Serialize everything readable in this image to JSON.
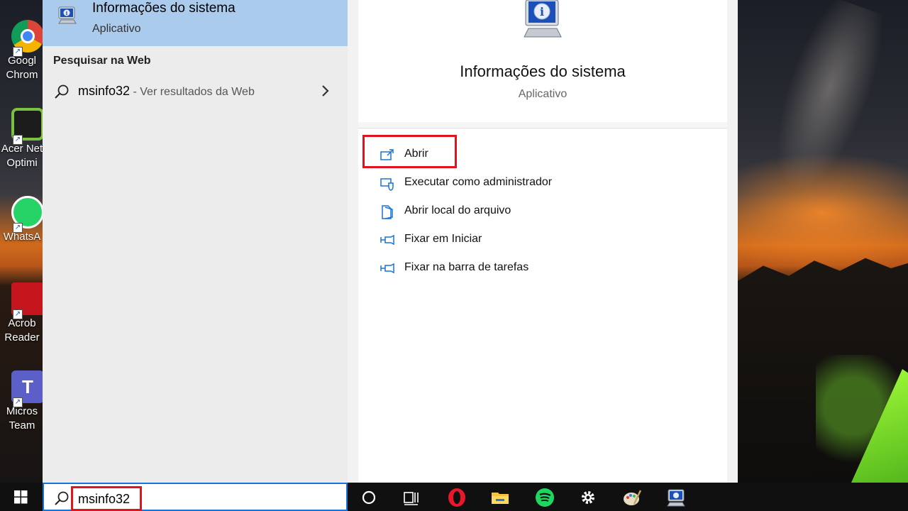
{
  "desktop": {
    "icons": [
      {
        "label": "Googl",
        "label2": "Chrom"
      },
      {
        "label": "Acer Net",
        "label2": "Optimi"
      },
      {
        "label": "WhatsA",
        "label2": ""
      },
      {
        "label": "Acrob",
        "label2": "Reader"
      },
      {
        "label": "Micros",
        "label2": "Team"
      }
    ]
  },
  "results": {
    "best_match": {
      "title": "Informações do sistema",
      "subtitle": "Aplicativo"
    },
    "web_header": "Pesquisar na Web",
    "web_row": {
      "query": "msinfo32",
      "suffix": " - Ver resultados da Web"
    }
  },
  "detail": {
    "title": "Informações do sistema",
    "subtitle": "Aplicativo",
    "actions": [
      {
        "label": "Abrir",
        "icon": "open-icon"
      },
      {
        "label": "Executar como administrador",
        "icon": "shield-icon"
      },
      {
        "label": "Abrir local do arquivo",
        "icon": "file-location-icon"
      },
      {
        "label": "Fixar em Iniciar",
        "icon": "pin-icon"
      },
      {
        "label": "Fixar na barra de tarefas",
        "icon": "pin-icon"
      }
    ]
  },
  "taskbar": {
    "search_text": "msinfo32",
    "apps": [
      "cortana-icon",
      "task-view-icon",
      "opera-icon",
      "file-explorer-icon",
      "spotify-icon",
      "settings-icon",
      "paint-icon",
      "system-info-icon"
    ]
  },
  "colors": {
    "accent": "#1a73d6",
    "highlight": "#e0141e",
    "selection": "#aacbeb",
    "action_icon": "#1a73d6"
  }
}
